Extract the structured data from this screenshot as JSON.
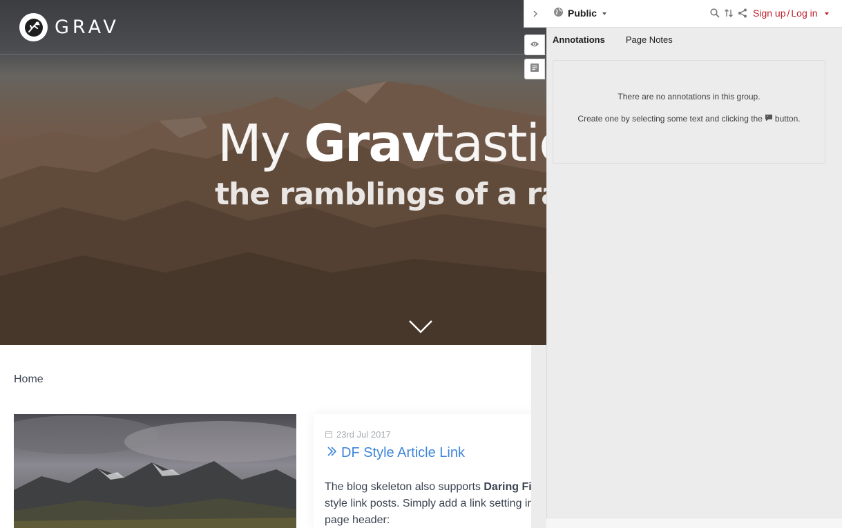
{
  "site": {
    "logo_text": "GRAV",
    "hero_title_light": "My ",
    "hero_title_bold": "Grav",
    "hero_title_tail": "tastic B",
    "hero_subtitle": "the ramblings of a ran"
  },
  "breadcrumb": {
    "home": "Home"
  },
  "post": {
    "date": "23rd Jul 2017",
    "title": "DF Style Article Link",
    "excerpt_start": "The blog skeleton also supports ",
    "excerpt_bold": "Daring Fire",
    "excerpt_line2": "style link posts. Simply add a link setting in y",
    "excerpt_line3": "page header:"
  },
  "sidebar": {
    "group_label": "Public",
    "login_signup": "Sign up",
    "login_separator": "/",
    "login_login": "Log in",
    "tabs": [
      {
        "label": "Annotations"
      },
      {
        "label": "Page Notes"
      }
    ],
    "empty_line1": "There are no annotations in this group.",
    "empty_line2_before": "Create one by selecting some text and clicking the",
    "empty_line2_after": "button."
  },
  "colors": {
    "accent_link": "#3d85d8",
    "login_red": "#bd1c2b",
    "sidebar_bg": "#ececec"
  },
  "icons": [
    "grav-logo-icon",
    "chevron-right-icon",
    "globe-icon",
    "search-icon",
    "sort-icon",
    "share-icon",
    "eye-icon",
    "note-icon",
    "chevron-down-icon",
    "calendar-icon",
    "double-chevron-icon",
    "annotate-icon"
  ]
}
